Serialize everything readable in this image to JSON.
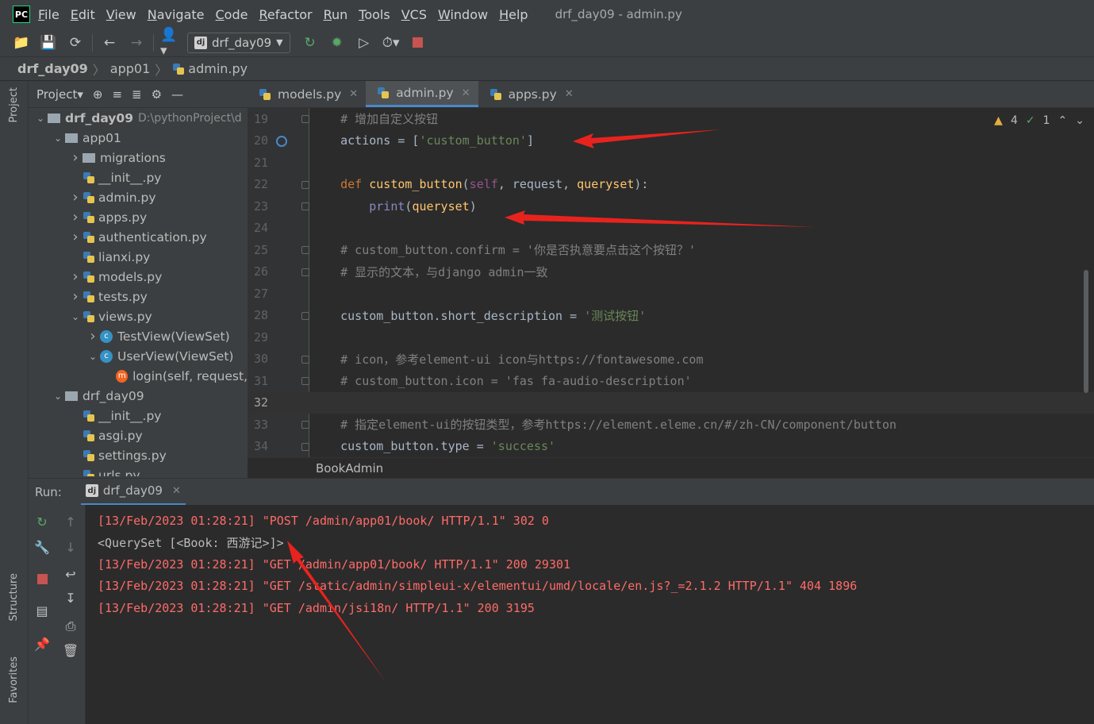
{
  "menubar": {
    "logo": "PC",
    "items": [
      "File",
      "Edit",
      "View",
      "Navigate",
      "Code",
      "Refactor",
      "Run",
      "Tools",
      "VCS",
      "Window",
      "Help"
    ],
    "window_title": "drf_day09 - admin.py"
  },
  "toolbar": {
    "run_config": "drf_day09"
  },
  "breadcrumbs": [
    "drf_day09",
    "app01",
    "admin.py"
  ],
  "left_stripe": {
    "project": "Project",
    "structure": "Structure",
    "favorites": "Favorites"
  },
  "project_panel": {
    "title": "Project▾",
    "tree": [
      {
        "label": "drf_day09",
        "extra": "D:\\pythonProject\\d",
        "type": "folder",
        "depth": 0,
        "expanded": true
      },
      {
        "label": "app01",
        "type": "folder",
        "depth": 1,
        "expanded": true
      },
      {
        "label": "migrations",
        "type": "folder",
        "depth": 2,
        "expanded": false
      },
      {
        "label": "__init__.py",
        "type": "py",
        "depth": 2
      },
      {
        "label": "admin.py",
        "type": "py",
        "depth": 2,
        "expandable": true
      },
      {
        "label": "apps.py",
        "type": "py",
        "depth": 2,
        "expandable": true
      },
      {
        "label": "authentication.py",
        "type": "py",
        "depth": 2,
        "expandable": true
      },
      {
        "label": "lianxi.py",
        "type": "py",
        "depth": 2
      },
      {
        "label": "models.py",
        "type": "py",
        "depth": 2,
        "expandable": true
      },
      {
        "label": "tests.py",
        "type": "py",
        "depth": 2,
        "expandable": true
      },
      {
        "label": "views.py",
        "type": "py",
        "depth": 2,
        "expanded": true
      },
      {
        "label": "TestView(ViewSet)",
        "type": "class",
        "depth": 3,
        "expandable": true
      },
      {
        "label": "UserView(ViewSet)",
        "type": "class",
        "depth": 3,
        "expanded": true
      },
      {
        "label": "login(self, request,",
        "type": "method",
        "depth": 4
      },
      {
        "label": "drf_day09",
        "type": "folder",
        "depth": 1,
        "expanded": true
      },
      {
        "label": "__init__.py",
        "type": "py",
        "depth": 2
      },
      {
        "label": "asgi.py",
        "type": "py",
        "depth": 2
      },
      {
        "label": "settings.py",
        "type": "py",
        "depth": 2
      },
      {
        "label": "urls.py",
        "type": "py",
        "depth": 2
      }
    ]
  },
  "editor_tabs": [
    {
      "label": "models.py",
      "active": false
    },
    {
      "label": "admin.py",
      "active": true
    },
    {
      "label": "apps.py",
      "active": false
    }
  ],
  "inspection": {
    "warnings": "4",
    "ok": "1"
  },
  "code_lines": [
    {
      "n": "19",
      "parts": [
        [
          "c-comment",
          "    # 增加自定义按钮"
        ]
      ]
    },
    {
      "n": "20",
      "parts": [
        [
          "c-plain",
          "    actions = ["
        ],
        [
          "c-str",
          "'custom_button'"
        ],
        [
          "c-plain",
          "]"
        ]
      ]
    },
    {
      "n": "21",
      "parts": []
    },
    {
      "n": "22",
      "parts": [
        [
          "c-kw",
          "    def "
        ],
        [
          "c-fn",
          "custom_button"
        ],
        [
          "c-plain",
          "("
        ],
        [
          "c-self",
          "self"
        ],
        [
          "c-plain",
          ", request, "
        ],
        [
          "c-fn",
          "queryset"
        ],
        [
          "c-plain",
          "):"
        ]
      ]
    },
    {
      "n": "23",
      "parts": [
        [
          "c-builtin",
          "        print"
        ],
        [
          "c-plain",
          "("
        ],
        [
          "c-fn",
          "queryset"
        ],
        [
          "c-plain",
          ")"
        ]
      ]
    },
    {
      "n": "24",
      "parts": []
    },
    {
      "n": "25",
      "parts": [
        [
          "c-comment",
          "    # custom_button.confirm = '你是否执意要点击这个按钮？'"
        ]
      ]
    },
    {
      "n": "26",
      "parts": [
        [
          "c-comment",
          "    # 显示的文本，与django admin一致"
        ]
      ]
    },
    {
      "n": "27",
      "parts": []
    },
    {
      "n": "28",
      "parts": [
        [
          "c-plain",
          "    custom_button.short_description = "
        ],
        [
          "c-str",
          "'测试按钮'"
        ]
      ]
    },
    {
      "n": "29",
      "parts": []
    },
    {
      "n": "30",
      "parts": [
        [
          "c-comment",
          "    # icon，参考element-ui icon与https://fontawesome.com"
        ]
      ]
    },
    {
      "n": "31",
      "parts": [
        [
          "c-comment",
          "    # custom_button.icon = 'fas fa-audio-description'"
        ]
      ]
    },
    {
      "n": "32",
      "parts": [],
      "current": true
    },
    {
      "n": "33",
      "parts": [
        [
          "c-comment",
          "    # 指定element-ui的按钮类型，参考https://element.eleme.cn/#/zh-CN/component/button"
        ]
      ]
    },
    {
      "n": "34",
      "parts": [
        [
          "c-plain",
          "    custom_button.type = "
        ],
        [
          "c-str",
          "'success'"
        ]
      ]
    }
  ],
  "editor_breadcrumb": "BookAdmin",
  "run_panel": {
    "label": "Run:",
    "tab": "drf_day09",
    "console": [
      {
        "cls": "con-red",
        "text": "[13/Feb/2023 01:28:21] \"POST /admin/app01/book/ HTTP/1.1\" 302 0"
      },
      {
        "cls": "con-white",
        "text": "<QuerySet [<Book: 西游记>]>"
      },
      {
        "cls": "con-red",
        "text": "[13/Feb/2023 01:28:21] \"GET /admin/app01/book/ HTTP/1.1\" 200 29301"
      },
      {
        "cls": "con-red",
        "text": "[13/Feb/2023 01:28:21] \"GET /static/admin/simpleui-x/elementui/umd/locale/en.js?_=2.1.2 HTTP/1.1\" 404 1896"
      },
      {
        "cls": "con-red",
        "text": "[13/Feb/2023 01:28:21] \"GET /admin/jsi18n/ HTTP/1.1\" 200 3195"
      }
    ]
  },
  "colors": {
    "annotation_arrow": "#e8231e",
    "accent": "#4a88c7"
  }
}
